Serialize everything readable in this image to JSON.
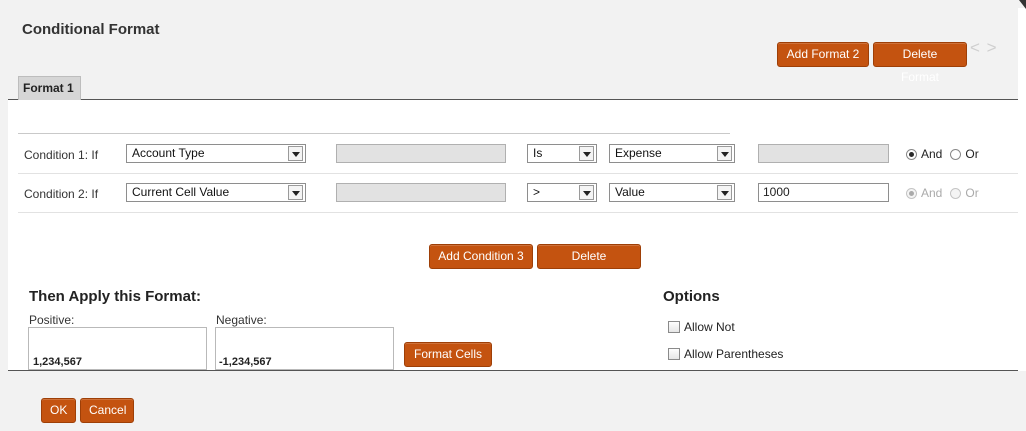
{
  "dialog": {
    "title": "Conditional Format"
  },
  "header_buttons": {
    "add_format": "Add Format 2",
    "delete_format": "Delete Format"
  },
  "nav": {
    "arrows": "< >"
  },
  "tabs": [
    {
      "label": "Format 1"
    }
  ],
  "conditions": [
    {
      "label": "Condition 1: If",
      "field": "Account Type",
      "operator": "Is",
      "value_type": "Expense",
      "value": "",
      "conjunction": {
        "and": "And",
        "or": "Or",
        "selected": "And",
        "enabled": true
      }
    },
    {
      "label": "Condition 2: If",
      "field": "Current Cell Value",
      "operator": ">",
      "value_type": "Value",
      "value": "1000",
      "conjunction": {
        "and": "And",
        "or": "Or",
        "selected": "And",
        "enabled": false
      }
    }
  ],
  "condition_buttons": {
    "add_condition": "Add Condition 3",
    "delete_condition": "Delete Condition"
  },
  "apply_format": {
    "heading": "Then Apply this Format:",
    "positive_label": "Positive:",
    "positive_value": "1,234,567",
    "negative_label": "Negative:",
    "negative_value": "-1,234,567",
    "format_cells": "Format Cells"
  },
  "options": {
    "heading": "Options",
    "allow_not": "Allow Not",
    "allow_parentheses": "Allow Parentheses"
  },
  "footer": {
    "ok": "OK",
    "cancel": "Cancel"
  },
  "colors": {
    "button": "#c45310",
    "header_bg": "#f2f2f2",
    "tab_bg": "#d6d6d6"
  }
}
